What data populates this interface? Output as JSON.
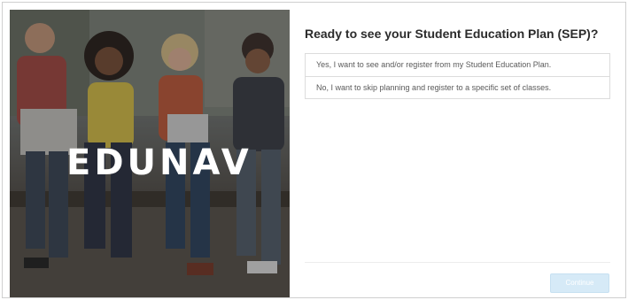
{
  "hero": {
    "logo_text": "EDUNAV"
  },
  "dialog": {
    "question": "Ready to see your Student Education Plan (SEP)?",
    "options": [
      {
        "label": "Yes, I want to see and/or register from my Student Education Plan."
      },
      {
        "label": "No, I want to skip planning and register to a specific set of classes."
      }
    ],
    "continue_label": "Continue"
  },
  "colors": {
    "continue_button_disabled": "#d6eaf7",
    "border": "#dcdcdc",
    "question_text": "#2b2b2b",
    "logo_accent": "#2f8fd6"
  }
}
